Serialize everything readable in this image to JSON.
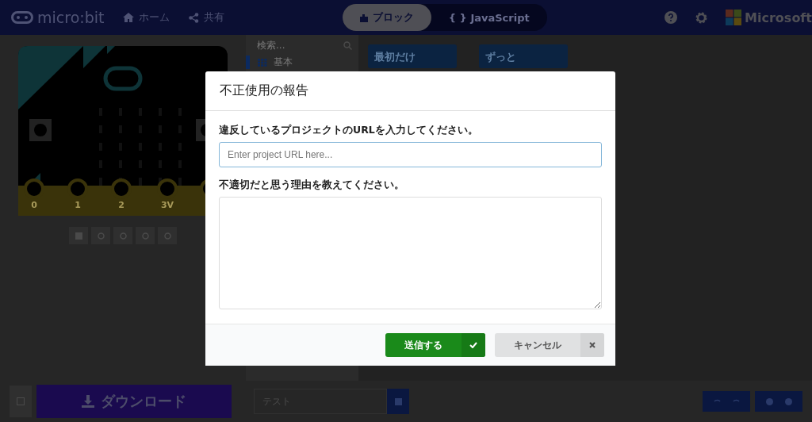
{
  "header": {
    "logo": "micro:bit",
    "nav": [
      {
        "label": "ホーム",
        "kind": "home"
      },
      {
        "label": "共有",
        "kind": "share"
      }
    ],
    "tabs": [
      {
        "label": "ブロック",
        "kind": "blocks",
        "selected": true
      },
      {
        "label": "{ } JavaScript",
        "kind": "code",
        "selected": false
      }
    ],
    "brand": "Microsoft"
  },
  "simulator": {
    "pins": [
      "0",
      "1",
      "2",
      "3V"
    ]
  },
  "toolbox": {
    "search": {
      "placeholder": "検索..."
    },
    "categories": [
      {
        "label": "基本",
        "selected": true
      }
    ]
  },
  "workspace": {
    "blocks": [
      "最初だけ",
      "ずっと"
    ]
  },
  "bottom_bar": {
    "download": "ダウンロード",
    "project_name": "テスト"
  },
  "dialog": {
    "title": "不正使用の報告",
    "url_label": "違反しているプロジェクトのURLを入力してください。",
    "url_field": {
      "placeholder": "Enter project URL here..."
    },
    "reason_label": "不適切だと思う理由を教えてください。",
    "buttons": [
      {
        "label": "送信する",
        "kind": "submit"
      },
      {
        "label": "キャンセル",
        "kind": "cancel"
      }
    ]
  }
}
